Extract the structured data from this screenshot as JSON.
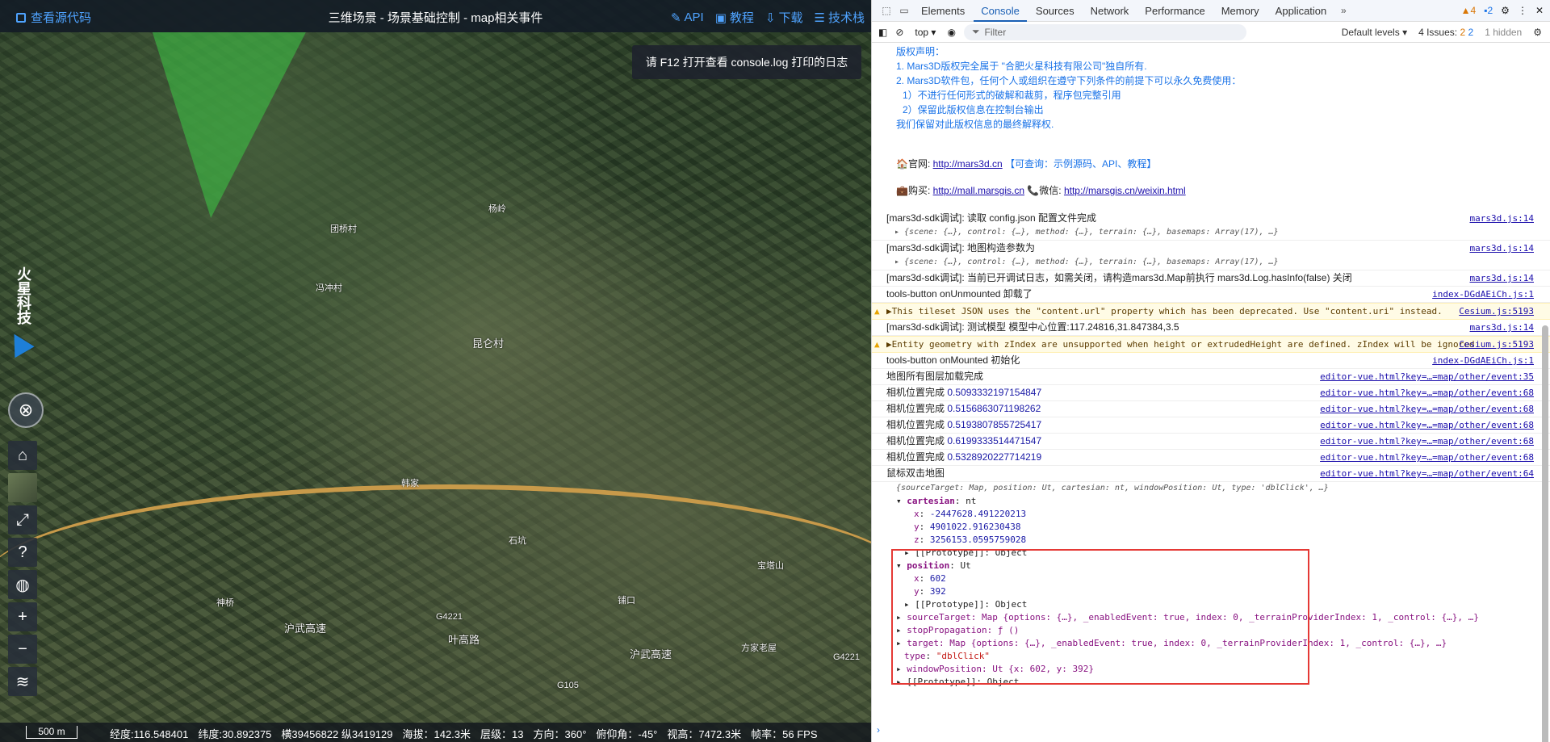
{
  "map": {
    "source_link": "查看源代码",
    "title": "三维场景 - 场景基础控制 - map相关事件",
    "links": [
      "API",
      "教程",
      "下载",
      "技术栈"
    ],
    "tip": "请 F12 打开查看 console.log 打印的日志",
    "logo_text": "火星科技",
    "villages": [
      "团桥村",
      "冯冲村",
      "昆仑村",
      "杨岭",
      "铺口",
      "神桥",
      "宝塔山",
      "石坑",
      "沪武高速",
      "叶高路",
      "沪武高速",
      "沪武高速",
      "G4221",
      "G4221",
      "G105",
      "方家老屋",
      "韩家"
    ],
    "toolbar": [
      "home-icon",
      "basemap-thumb",
      "fullscreen-icon",
      "help-icon",
      "globe-icon",
      "zoom-in-icon",
      "zoom-out-icon",
      "layers-icon"
    ],
    "status": {
      "scale": "500 m",
      "lon": "经度:116.548401",
      "lat": "纬度:30.892375",
      "proj": "横39456822 纵3419129",
      "alt": "海拔：142.3米",
      "level": "层级：13",
      "heading": "方向：360°",
      "pitch": "俯仰角：-45°",
      "height": "视高：7472.3米",
      "fps": "帧率：56 FPS"
    }
  },
  "devtools": {
    "tabs": [
      "Elements",
      "Console",
      "Sources",
      "Network",
      "Performance",
      "Memory",
      "Application"
    ],
    "active_tab": "Console",
    "warn_count": "4",
    "err_count": "2",
    "context": "top",
    "filter_placeholder": "Filter",
    "levels": "Default levels",
    "issues": "4 Issues:",
    "issues_w": "2",
    "issues_e": "2",
    "hidden": "1 hidden",
    "copyright": [
      "版权声明：",
      "1. Mars3D版权完全属于 \"合肥火星科技有限公司\"独自所有.",
      "2. Mars3D软件包，任何个人或组织在遵守下列条件的前提下可以永久免费使用：",
      "  1）不进行任何形式的破解和裁剪，程序包完整引用",
      "  2）保留此版权信息在控制台输出",
      "我们保留对此版权信息的最终解释权."
    ],
    "site_label": "🏠官网: ",
    "site_url": "http://mars3d.cn",
    "site_note": " 【可查询：示例源码、API、教程】",
    "buy_label": "💼购买: ",
    "buy_url": "http://mall.marsgis.cn",
    "wx_label": "  📞微信: ",
    "wx_url": "http://marsgis.cn/weixin.html",
    "lines": [
      {
        "text": "[mars3d-sdk调试]: 读取 config.json 配置文件完成",
        "src": "mars3d.js:14",
        "obj": "▸ {scene: {…}, control: {…}, method: {…}, terrain: {…}, basemaps: Array(17), …}"
      },
      {
        "text": "[mars3d-sdk调试]: 地图构造参数为",
        "src": "mars3d.js:14",
        "obj": "▸ {scene: {…}, control: {…}, method: {…}, terrain: {…}, basemaps: Array(17), …}"
      },
      {
        "text": "[mars3d-sdk调试]: 当前已开调试日志，如需关闭，请构造mars3d.Map前执行 mars3d.Log.hasInfo(false) 关闭",
        "src": "mars3d.js:14"
      },
      {
        "text": "tools-button onUnmounted 卸载了",
        "src": "index-DGdAEiCh.js:1"
      },
      {
        "text": "▶This tileset JSON uses the \"content.url\" property which has been deprecated. Use \"content.uri\" instead.",
        "src": "Cesium.js:5193",
        "warn": true
      },
      {
        "text": "[mars3d-sdk调试]: 测试模型 模型中心位置:117.24816,31.847384,3.5",
        "src": "mars3d.js:14"
      },
      {
        "text": "▶Entity geometry with zIndex are unsupported when height or extrudedHeight are defined.  zIndex will be ignored",
        "src": "Cesium.js:5193",
        "warn": true
      },
      {
        "text": "tools-button onMounted 初始化",
        "src": "index-DGdAEiCh.js:1"
      },
      {
        "text": "地图所有图层加载完成",
        "src": "editor-vue.html?key=…=map/other/event:35"
      },
      {
        "text": "相机位置完成 ",
        "num": "0.5093332197154847",
        "src": "editor-vue.html?key=…=map/other/event:68"
      },
      {
        "text": "相机位置完成 ",
        "num": "0.5156863071198262",
        "src": "editor-vue.html?key=…=map/other/event:68"
      },
      {
        "text": "相机位置完成 ",
        "num": "0.5193807855725417",
        "src": "editor-vue.html?key=…=map/other/event:68"
      },
      {
        "text": "相机位置完成 ",
        "num": "0.6199333514471547",
        "src": "editor-vue.html?key=…=map/other/event:68"
      },
      {
        "text": "相机位置完成 ",
        "num": "0.5328920227714219",
        "src": "editor-vue.html?key=…=map/other/event:68"
      },
      {
        "text": "鼠标双击地图",
        "src": "editor-vue.html?key=…=map/other/event:64"
      }
    ],
    "tree": {
      "head": "{sourceTarget: Map, position: Ut, cartesian: nt, windowPosition: Ut, type: 'dblClick', …}",
      "cartesian_label": "cartesian",
      "cartesian_type": "nt",
      "x": "-2447628.491220213",
      "y": "4901022.916230438",
      "z": "3256153.0595759028",
      "proto": "[[Prototype]]: Object",
      "position_label": "position",
      "position_type": "Ut",
      "px": "602",
      "py": "392",
      "sourceTarget": "sourceTarget: Map {options: {…}, _enabledEvent: true, index: 0, _terrainProviderIndex: 1, _control: {…}, …}",
      "stopPropagation": "stopPropagation: ƒ ()",
      "target": "target: Map {options: {…}, _enabledEvent: true, index: 0, _terrainProviderIndex: 1, _control: {…}, …}",
      "type_label": "type",
      "type_val": "\"dblClick\"",
      "windowPosition": "windowPosition: Ut {x: 602, y: 392}",
      "proto2": "[[Prototype]]: Object"
    },
    "prompt": "›"
  },
  "colors": {
    "accent": "#4fa3ff",
    "devtools_link": "#1a73e8",
    "highlight": "#e53935"
  }
}
